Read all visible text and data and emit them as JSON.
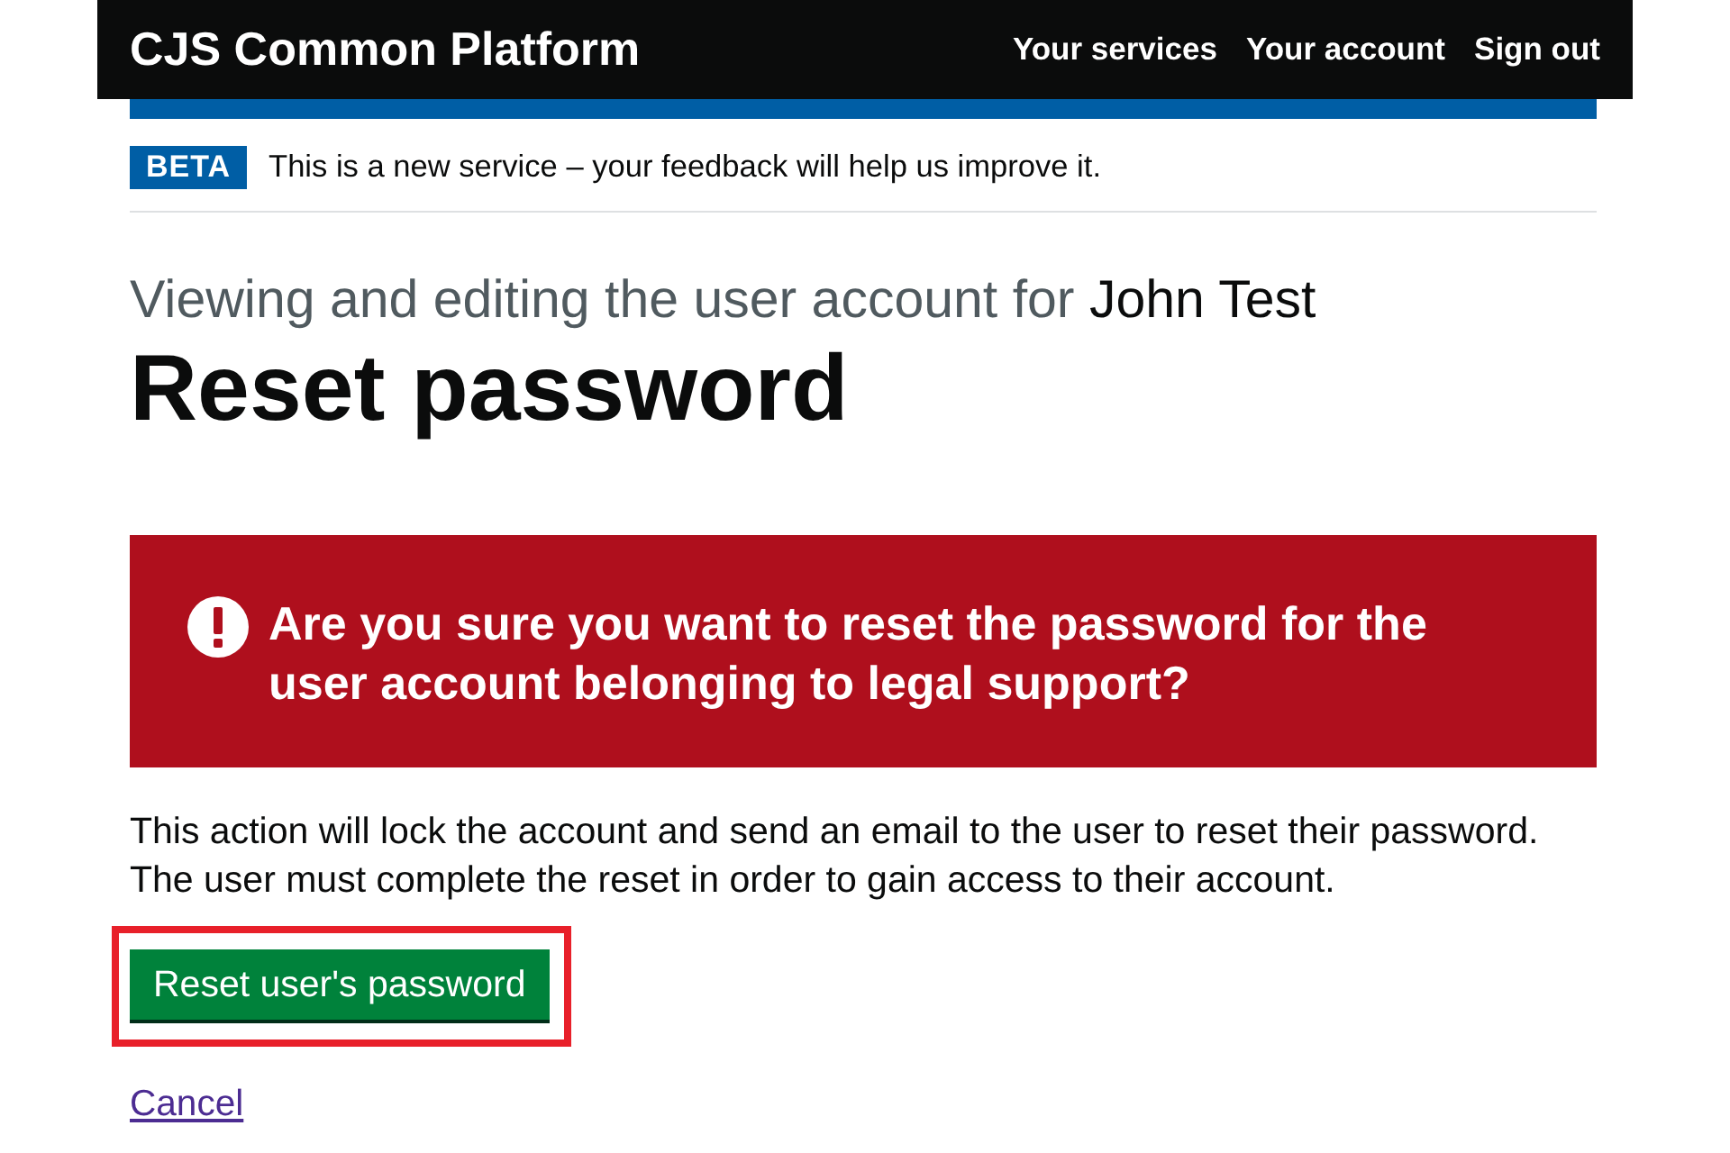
{
  "header": {
    "title": "CJS Common Platform",
    "nav": [
      "Your services",
      "Your account",
      "Sign out"
    ]
  },
  "phase_banner": {
    "tag": "BETA",
    "text": "This is a new service – your feedback will help us improve it."
  },
  "caption": {
    "text": "Viewing and editing the user account for ",
    "name": "John Test"
  },
  "heading": "Reset password",
  "warning": {
    "text": "Are you sure you want to reset the password for the user account belonging to legal support?"
  },
  "body": "This action will lock the account and send an email to the user to reset their password.\nThe user must complete the reset in order to gain access to their account.",
  "action_button": {
    "label": "Reset user's password",
    "highlighted": true
  },
  "cancel_link": "Cancel"
}
